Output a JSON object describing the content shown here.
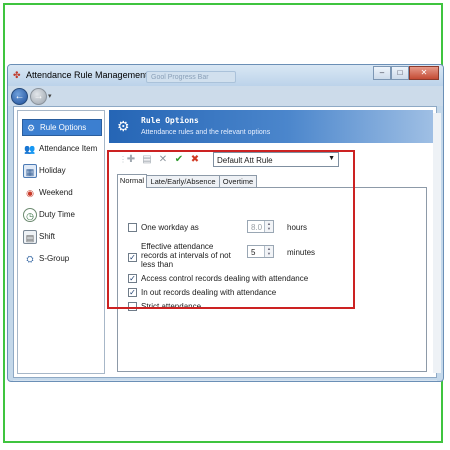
{
  "window": {
    "title": "Attendance Rule Management",
    "ghost_tab": "Gool Progress Bar",
    "buttons": {
      "minimize": "–",
      "maximize": "□",
      "close": "✕"
    }
  },
  "nav": {
    "back": "←",
    "forward": "→",
    "dropdown": "▾"
  },
  "sidebar": {
    "items": [
      {
        "label": "Rule Options",
        "icon": "gear-icon",
        "active": true
      },
      {
        "label": "Attendance Item",
        "icon": "users-icon",
        "active": false
      },
      {
        "label": "Holiday",
        "icon": "calendar-icon",
        "active": false
      },
      {
        "label": "Weekend",
        "icon": "weekend-icon",
        "active": false
      },
      {
        "label": "Duty Time",
        "icon": "clock-icon",
        "active": false
      },
      {
        "label": "Shift",
        "icon": "shift-icon",
        "active": false
      },
      {
        "label": "S-Group",
        "icon": "group-icon",
        "active": false
      }
    ]
  },
  "banner": {
    "title": "Rule Options",
    "subtitle": "Attendance rules and the relevant options"
  },
  "toolbar": {
    "add": "✚",
    "edit": "▤",
    "delete": "✕",
    "confirm": "✔",
    "cancel": "✖",
    "selected_rule": "Default Att Rule",
    "dropdown_arrow": "▼"
  },
  "tabs": [
    {
      "label": "Normal",
      "active": true
    },
    {
      "label": "Late/Early/Absence",
      "active": false
    },
    {
      "label": "Overtime",
      "active": false
    }
  ],
  "options": {
    "one_workday": {
      "label": "One workday as",
      "checked": false,
      "value": "8.0",
      "unit": "hours",
      "enabled": false
    },
    "effective": {
      "label_lines": [
        "Effective attendance",
        "records at intervals of not",
        "less than"
      ],
      "checked": true,
      "value": "5",
      "unit": "minutes"
    },
    "access_control": {
      "label": "Access control records dealing with attendance",
      "checked": true
    },
    "in_out": {
      "label": "In out records dealing with attendance",
      "checked": true
    },
    "strict": {
      "label": "Strict attendance",
      "checked": false
    }
  },
  "colors": {
    "highlight_box": "#cc2222",
    "frame": "#3fc43f",
    "accent": "#3c7fd0"
  }
}
